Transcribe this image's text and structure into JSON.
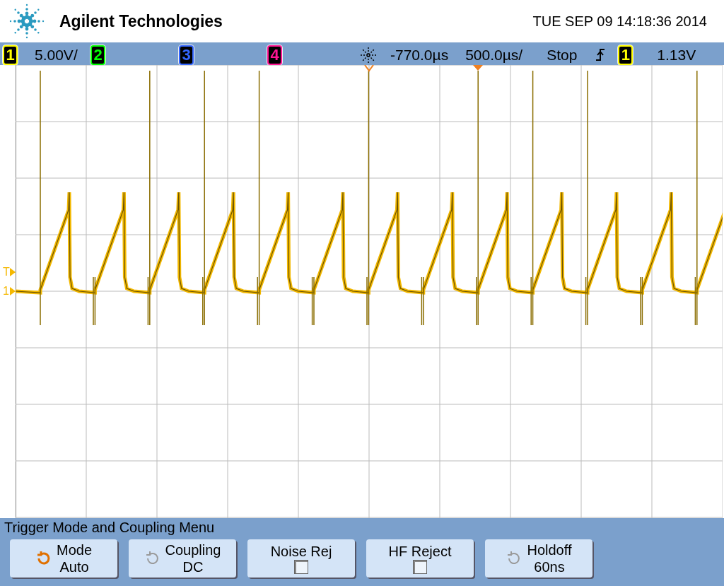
{
  "header": {
    "brand": "Agilent Technologies",
    "datetime": "TUE SEP 09 14:18:36 2014"
  },
  "status_bar": {
    "channels": [
      {
        "number": "1",
        "color": "#ffff00",
        "scale": "5.00V/"
      },
      {
        "number": "2",
        "color": "#00ff00"
      },
      {
        "number": "3",
        "color": "#3366ff"
      },
      {
        "number": "4",
        "color": "#ff1493"
      }
    ],
    "delay": "-770.0µs",
    "timebase": "500.0µs/",
    "run_state": "Stop",
    "trigger_source": {
      "number": "1",
      "color": "#ffff00"
    },
    "trigger_level": "1.13V"
  },
  "display": {
    "trigger_marker": "T",
    "channel_marker": "1"
  },
  "menu": {
    "title": "Trigger Mode and Coupling Menu",
    "buttons": [
      {
        "kind": "select",
        "label": "Mode",
        "value": "Auto",
        "selected": true
      },
      {
        "kind": "select",
        "label": "Coupling",
        "value": "DC",
        "selected": false
      },
      {
        "kind": "checkbox",
        "label": "Noise Rej",
        "checked": false,
        "selected": false
      },
      {
        "kind": "checkbox",
        "label": "HF Reject",
        "checked": false,
        "selected": false
      },
      {
        "kind": "select",
        "label": "Holdoff",
        "value": "60ns",
        "selected": false
      }
    ]
  }
}
